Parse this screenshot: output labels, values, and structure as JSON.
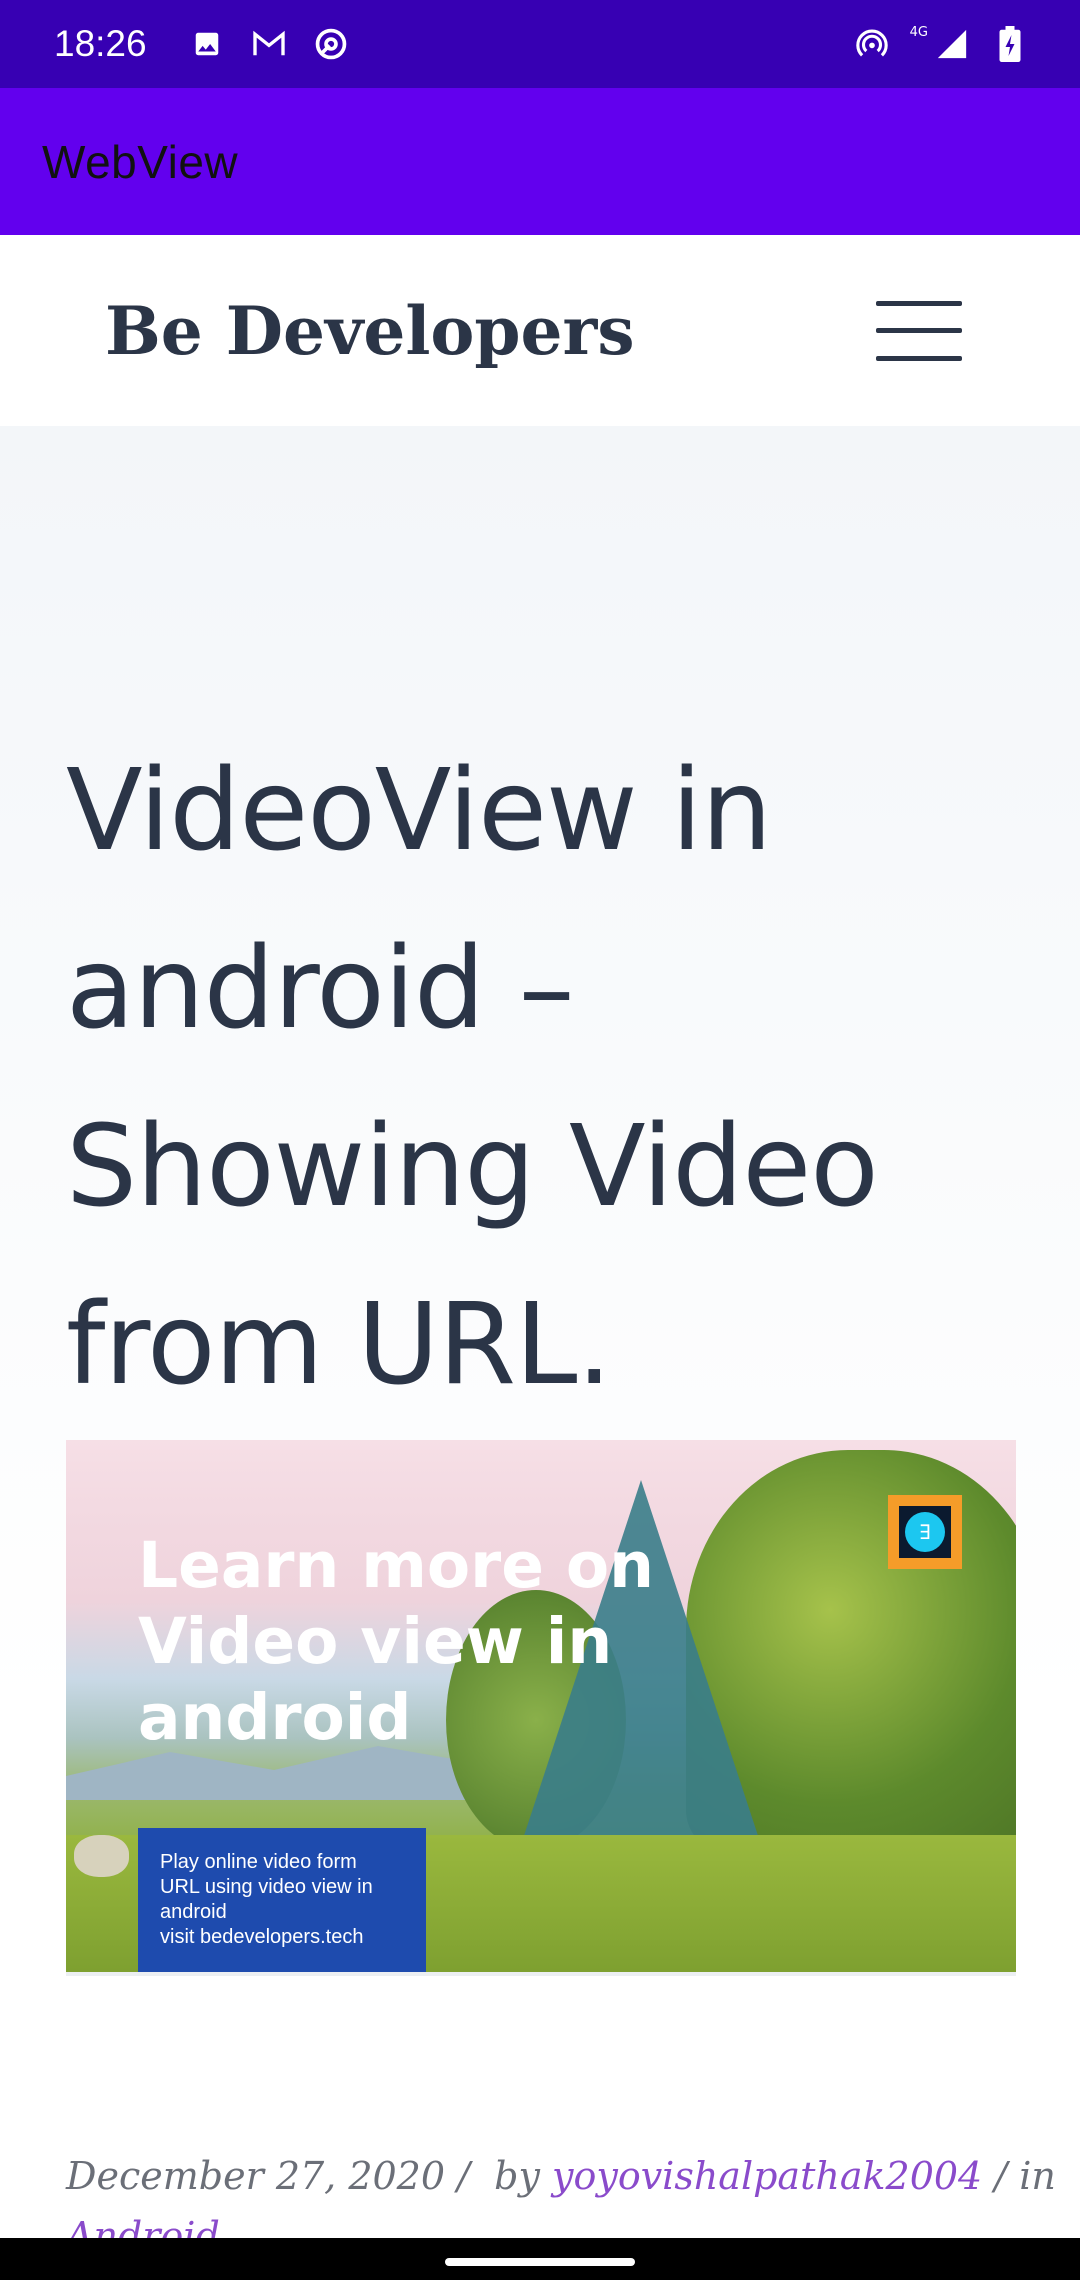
{
  "status_bar": {
    "time": "18:26",
    "network": "4G",
    "left_icons": [
      "image-icon",
      "gmail-icon",
      "at-sign-icon"
    ],
    "right_icons": [
      "hotspot-icon",
      "signal-icon",
      "battery-charging-icon"
    ]
  },
  "app_bar": {
    "title": "WebView"
  },
  "site": {
    "name": "Be Developers",
    "menu_icon": "hamburger-menu-icon"
  },
  "post": {
    "title": "VideoView in android – Showing Video from URL.",
    "featured_image": {
      "heading": "Learn more on Video view in android",
      "caption_lines": [
        "Play online video form",
        "URL using video view in",
        "android",
        "visit bedevelopers.tech"
      ],
      "logo_letter": "∃"
    },
    "meta": {
      "date": "December 27, 2020",
      "separator": "/",
      "by_label": "by",
      "author": "yoyovishalpathak2004",
      "in_label": "in",
      "category": "Android"
    }
  },
  "colors": {
    "status_bar": "#3700b3",
    "app_bar": "#6200ee",
    "title_text": "#2b3547",
    "link": "#8a4bcb",
    "caption_box": "#1e4bae"
  }
}
